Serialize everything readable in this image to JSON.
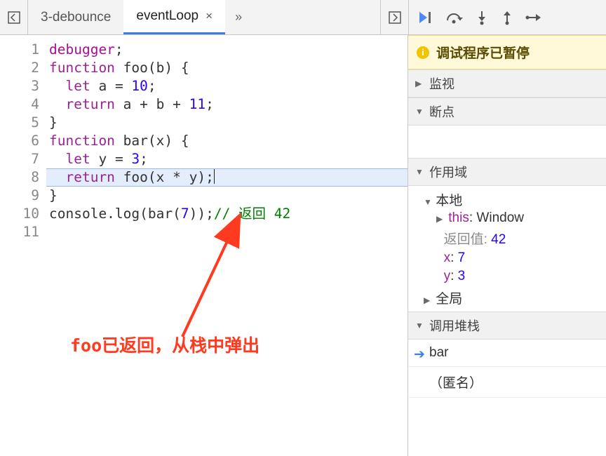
{
  "tabs": {
    "inactive": "3-debounce",
    "active": "eventLoop"
  },
  "controls": {
    "resume": "resume",
    "step_over": "step_over",
    "step_into": "step_into",
    "step_out": "step_out",
    "step": "step"
  },
  "banner": "调试程序已暂停",
  "sections": {
    "watch": "监视",
    "breakpoints": "断点",
    "scope": "作用域",
    "callstack": "调用堆栈"
  },
  "scope": {
    "local_label": "本地",
    "this_label": "this",
    "this_value": "Window",
    "return_label": "返回值",
    "return_value": "42",
    "vars": [
      {
        "name": "x",
        "value": "7"
      },
      {
        "name": "y",
        "value": "3"
      }
    ],
    "global_label": "全局"
  },
  "callstack": [
    {
      "name": "bar",
      "current": true
    },
    {
      "name": "（匿名）",
      "current": false
    }
  ],
  "code": {
    "lines": [
      {
        "n": 1,
        "t": [
          [
            "k-dbg",
            "debugger"
          ],
          [
            "",
            ";"
          ]
        ]
      },
      {
        "n": 2,
        "t": [
          [
            "k-fn",
            "function"
          ],
          [
            "",
            " foo(b) {"
          ]
        ]
      },
      {
        "n": 3,
        "t": [
          [
            "",
            "  "
          ],
          [
            "k-let",
            "let"
          ],
          [
            "",
            " a = "
          ],
          [
            "k-num",
            "10"
          ],
          [
            "",
            ";"
          ]
        ]
      },
      {
        "n": 4,
        "t": [
          [
            "",
            "  "
          ],
          [
            "k-ret",
            "return"
          ],
          [
            "",
            " a + b + "
          ],
          [
            "k-num",
            "11"
          ],
          [
            "",
            ";"
          ]
        ]
      },
      {
        "n": 5,
        "t": [
          [
            "",
            "}"
          ]
        ]
      },
      {
        "n": 6,
        "t": [
          [
            "",
            ""
          ]
        ]
      },
      {
        "n": 7,
        "t": [
          [
            "k-fn",
            "function"
          ],
          [
            "",
            " bar(x) {"
          ]
        ]
      },
      {
        "n": 8,
        "t": [
          [
            "",
            "  "
          ],
          [
            "k-let",
            "let"
          ],
          [
            "",
            " y = "
          ],
          [
            "k-num",
            "3"
          ],
          [
            "",
            ";"
          ]
        ]
      },
      {
        "n": 9,
        "hl": true,
        "t": [
          [
            "",
            "  "
          ],
          [
            "k-ret",
            "return"
          ],
          [
            "",
            " foo(x * y);"
          ]
        ]
      },
      {
        "n": 10,
        "t": [
          [
            "",
            "}"
          ]
        ]
      },
      {
        "n": 11,
        "t": [
          [
            "",
            "console.log(bar("
          ],
          [
            "k-num",
            "7"
          ],
          [
            "",
            "));"
          ],
          [
            "k-cmt",
            "// 返回 42"
          ]
        ]
      }
    ]
  },
  "annotation": "foo已返回，从栈中弹出"
}
